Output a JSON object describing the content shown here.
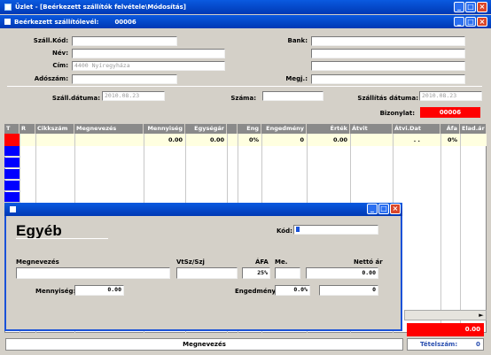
{
  "app": {
    "title": "Üzlet - [Beérkezett szállítók felvétele\\Módosítás]"
  },
  "inner_window": {
    "title": "Beérkezett szállítólevél:",
    "number": "00006"
  },
  "header_form": {
    "szall_kod_label": "Száll.Kód:",
    "nev_label": "Név:",
    "cim_label": "Cím:",
    "cim_value": "4400 Nyíregyháza",
    "adoszam_label": "Adószám:",
    "bank_label": "Bank:",
    "megj_label": "Megj.:",
    "szall_datuma_label": "Száll.dátuma:",
    "szall_datuma_value": "2010.08.23",
    "szama_label": "Száma:",
    "szallitas_datuma_label": "Szállítás dátuma:",
    "szallitas_datuma_value": "2010.08.23",
    "bizonylat_label": "Bizonylat:",
    "bizonylat_value": "00006"
  },
  "grid": {
    "columns": [
      "T",
      "R",
      "Cikkszám",
      "Megnevezés",
      "Mennyiség",
      "Egységár",
      "Eng",
      "Engedmény",
      "Érték",
      "Átvit",
      "Átvi.Dat",
      "Áfa",
      "Elad.ár"
    ],
    "row": {
      "mennyiseg": "0.00",
      "egysegar": "0.00",
      "eng": "0%",
      "engedmeny": "0",
      "ertek": "0.00",
      "atvi_dat": ". .",
      "afa": "0%"
    }
  },
  "footer": {
    "total": "0.00",
    "megnevezes_label": "Megnevezés",
    "tetelszam_label": "Tételszám:",
    "tetelszam_value": "0"
  },
  "dialog": {
    "heading": "Egyéb",
    "kod_label": "Kód:",
    "megnevezes_label": "Megnevezés",
    "vtsz_label": "VtSz/Szj",
    "afa_label": "ÁFA",
    "afa_value": "25%",
    "me_label": "Me.",
    "netto_label": "Nettó ár",
    "netto_value": "0.00",
    "mennyiseg_label": "Mennyiség:",
    "mennyiseg_value": "0.00",
    "engedmeny_label": "Engedmény:",
    "engedmeny_pct": "0.0%",
    "engedmeny_value": "0"
  },
  "colors": {
    "titlebar": "#0a5ae0",
    "highlight": "#ff0000",
    "row_marker": "#0000ff",
    "grid_header": "#8a8a8a"
  }
}
